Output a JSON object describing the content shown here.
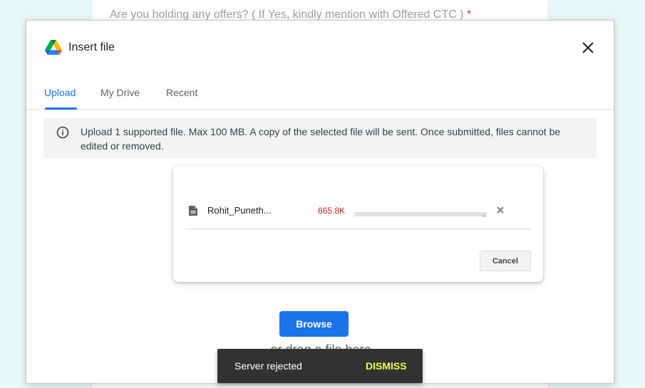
{
  "background_form": {
    "question": "Are you holding any offers? ( If Yes, kindly mention with Offered CTC )",
    "required_mark": "*"
  },
  "dialog": {
    "title": "Insert file",
    "close_icon": "close-icon",
    "logo_icon": "google-drive-icon"
  },
  "tabs": [
    {
      "label": "Upload",
      "active": true
    },
    {
      "label": "My Drive",
      "active": false
    },
    {
      "label": "Recent",
      "active": false
    }
  ],
  "info": {
    "icon": "info-icon",
    "text": "Upload 1 supported file. Max 100 MB. A copy of the selected file will be sent. Once submitted, files cannot be edited or removed."
  },
  "upload": {
    "file_icon": "document-icon",
    "file_name": "Rohit_Puneth...",
    "file_size": "665.8K",
    "progress": 1.0,
    "progress_dots": "...",
    "remove_icon": "close-icon",
    "cancel_label": "Cancel"
  },
  "browse": {
    "button_label": "Browse",
    "drag_text": "or drag a file here"
  },
  "snackbar": {
    "message": "Server rejected",
    "action_label": "DISMISS"
  },
  "colors": {
    "accent": "#1a73e8",
    "error": "#c5221f",
    "snackbar_action": "#eeff41"
  }
}
